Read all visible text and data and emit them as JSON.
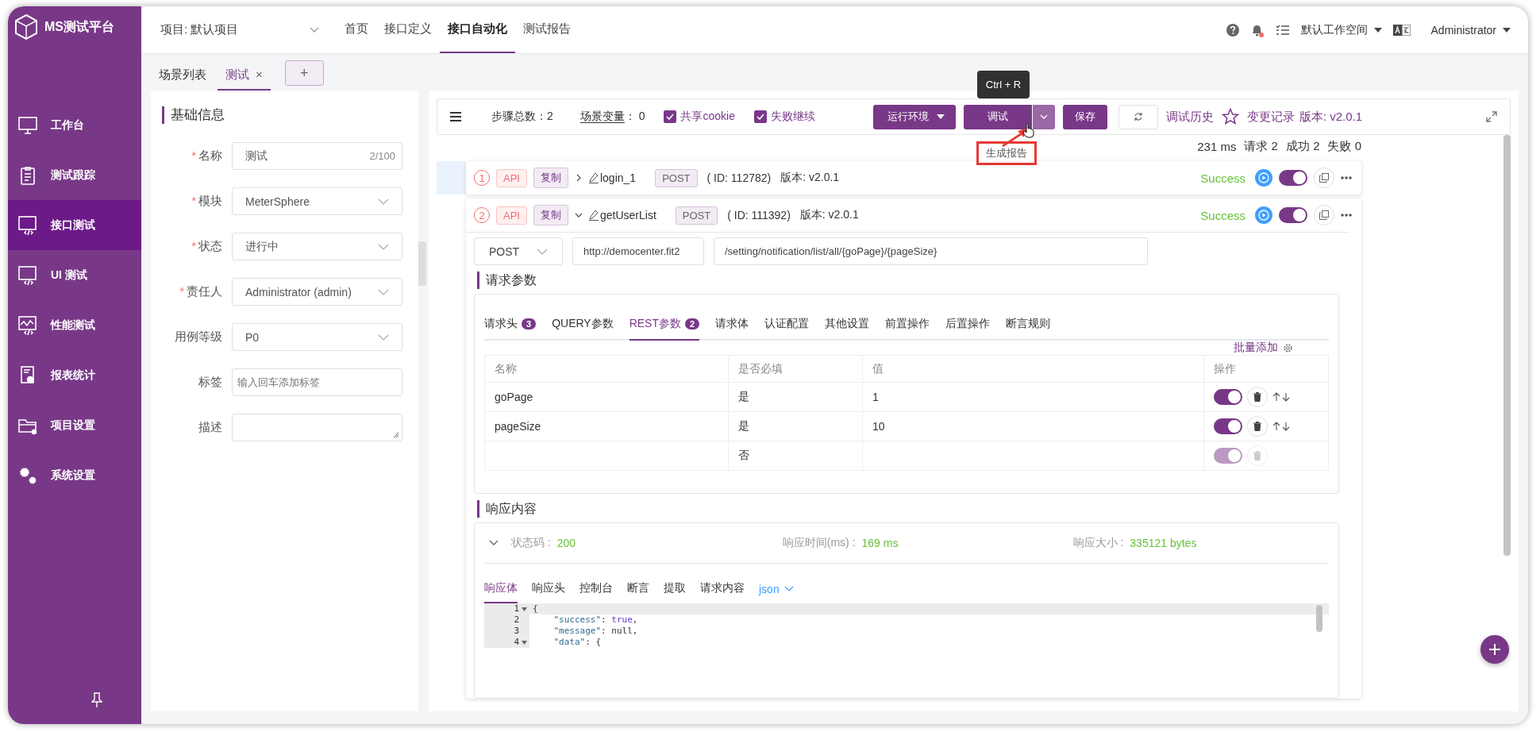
{
  "logo": {
    "title": "MS测试平台"
  },
  "sidebar": {
    "items": [
      {
        "label": "工作台",
        "selected": false
      },
      {
        "label": "测试跟踪",
        "selected": false
      },
      {
        "label": "接口测试",
        "selected": true
      },
      {
        "label": "UI 测试",
        "selected": false
      },
      {
        "label": "性能测试",
        "selected": false
      },
      {
        "label": "报表统计",
        "selected": false
      },
      {
        "label": "项目设置",
        "selected": false
      },
      {
        "label": "系统设置",
        "selected": false
      }
    ]
  },
  "topbar": {
    "project": "项目: 默认项目",
    "nav": [
      {
        "label": "首页",
        "selected": false
      },
      {
        "label": "接口定义",
        "selected": false
      },
      {
        "label": "接口自动化",
        "selected": true
      },
      {
        "label": "测试报告",
        "selected": false
      }
    ],
    "workspace": "默认工作空间",
    "user": "Administrator"
  },
  "tabs": [
    {
      "label": "场景列表",
      "selected": false
    },
    {
      "label": "测试",
      "selected": true,
      "close": "×"
    }
  ],
  "add_tab": "+",
  "basic_info": {
    "title": "基础信息",
    "fields": [
      {
        "label": "名称",
        "mark": "*",
        "kind": "input",
        "value": "测试",
        "counter": "2/100"
      },
      {
        "label": "模块",
        "mark": "*",
        "kind": "select",
        "value": "MeterSphere"
      },
      {
        "label": "状态",
        "mark": "*",
        "kind": "select",
        "value": "进行中"
      },
      {
        "label": "责任人",
        "mark": "*",
        "kind": "select",
        "value": "Administrator (admin)"
      },
      {
        "label": "用例等级",
        "kind": "select",
        "value": "P0"
      },
      {
        "label": "标签",
        "kind": "input",
        "placeholder": "输入回车添加标签"
      },
      {
        "label": "描述",
        "kind": "textarea"
      }
    ]
  },
  "toolbar": {
    "steps_label": "步骤总数：",
    "steps": "2",
    "vars_label": "场景变量",
    "vars": "：  0",
    "checks": [
      {
        "label": "共享cookie",
        "checked": true
      },
      {
        "label": "失败继续",
        "checked": true
      }
    ],
    "env_button": "运行环境",
    "debug_button": "调试",
    "save_button": "保存",
    "history": "调试历史",
    "changes": "变更记录",
    "version": "版本: v2.0.1"
  },
  "tooltip": "Ctrl + R",
  "dropdown": {
    "items": [
      "生成报告"
    ]
  },
  "stats": [
    "231 ms",
    "请求 2",
    "成功 2",
    "失败 0"
  ],
  "steps": [
    {
      "index": "1",
      "type": "API",
      "tag": "复制",
      "expanded": false,
      "name": "login_1",
      "method": "POST",
      "id": "( ID: 112782)",
      "version": "版本: v2.0.1",
      "status": "Success",
      "enabled": true,
      "selected": true
    },
    {
      "index": "2",
      "type": "API",
      "tag": "复制",
      "expanded": true,
      "name": "getUserList",
      "method": "POST",
      "id": "( ID: 111392)",
      "version": "版本: v2.0.1",
      "status": "Success",
      "enabled": true,
      "selected": false
    }
  ],
  "request": {
    "method": "POST",
    "base_url": "http://democenter.fit2",
    "path": "/setting/notification/list/all/{goPage}/{pageSize}"
  },
  "params": {
    "title": "请求参数",
    "tabs": [
      {
        "label": "请求头",
        "count": "3",
        "selected": false
      },
      {
        "label": "QUERY参数",
        "selected": false
      },
      {
        "label": "REST参数",
        "count": "2",
        "selected": true
      },
      {
        "label": "请求体",
        "selected": false
      },
      {
        "label": "认证配置",
        "selected": false
      },
      {
        "label": "其他设置",
        "selected": false
      },
      {
        "label": "前置操作",
        "selected": false
      },
      {
        "label": "后置操作",
        "selected": false
      },
      {
        "label": "断言规则",
        "selected": false
      }
    ],
    "batch_add": "批量添加",
    "columns": [
      "名称",
      "是否必填",
      "值",
      "操作"
    ],
    "rows": [
      {
        "name": "goPage",
        "required": "是",
        "value": "1",
        "enabled": true,
        "disabled": false
      },
      {
        "name": "pageSize",
        "required": "是",
        "value": "10",
        "enabled": true,
        "disabled": false
      },
      {
        "required": "否",
        "enabled": true,
        "disabled": true
      }
    ]
  },
  "response": {
    "title": "响应内容",
    "status_label": "状态码 :",
    "status": "200",
    "time_label": "响应时间(ms) :",
    "time": "169 ms",
    "size_label": "响应大小 :",
    "size": "335121 bytes",
    "tabs": [
      {
        "label": "响应体",
        "kind": "tab",
        "selected": true
      },
      {
        "label": "响应头",
        "kind": "tab",
        "selected": false
      },
      {
        "label": "控制台",
        "kind": "tab",
        "selected": false
      },
      {
        "label": "断言",
        "kind": "tab",
        "selected": false
      },
      {
        "label": "提取",
        "kind": "tab",
        "selected": false
      },
      {
        "label": "请求内容",
        "kind": "tab",
        "selected": false
      },
      {
        "label": "json",
        "kind": "format",
        "selected": false
      }
    ],
    "code": [
      {
        "line": "1",
        "fold": true,
        "tokens": [
          {
            "t": "{",
            "kind": "plain"
          }
        ]
      },
      {
        "line": "2",
        "fold": false,
        "tokens": [
          {
            "t": "    \"success\"",
            "kind": "key"
          },
          {
            "t": ": ",
            "kind": "plain"
          },
          {
            "t": "true",
            "kind": "bool"
          },
          {
            "t": ",",
            "kind": "plain"
          }
        ]
      },
      {
        "line": "3",
        "fold": false,
        "tokens": [
          {
            "t": "    \"message\"",
            "kind": "key"
          },
          {
            "t": ": null,",
            "kind": "plain"
          }
        ]
      },
      {
        "line": "4",
        "fold": true,
        "tokens": [
          {
            "t": "    \"data\"",
            "kind": "key"
          },
          {
            "t": ": {",
            "kind": "plain"
          }
        ]
      }
    ]
  }
}
